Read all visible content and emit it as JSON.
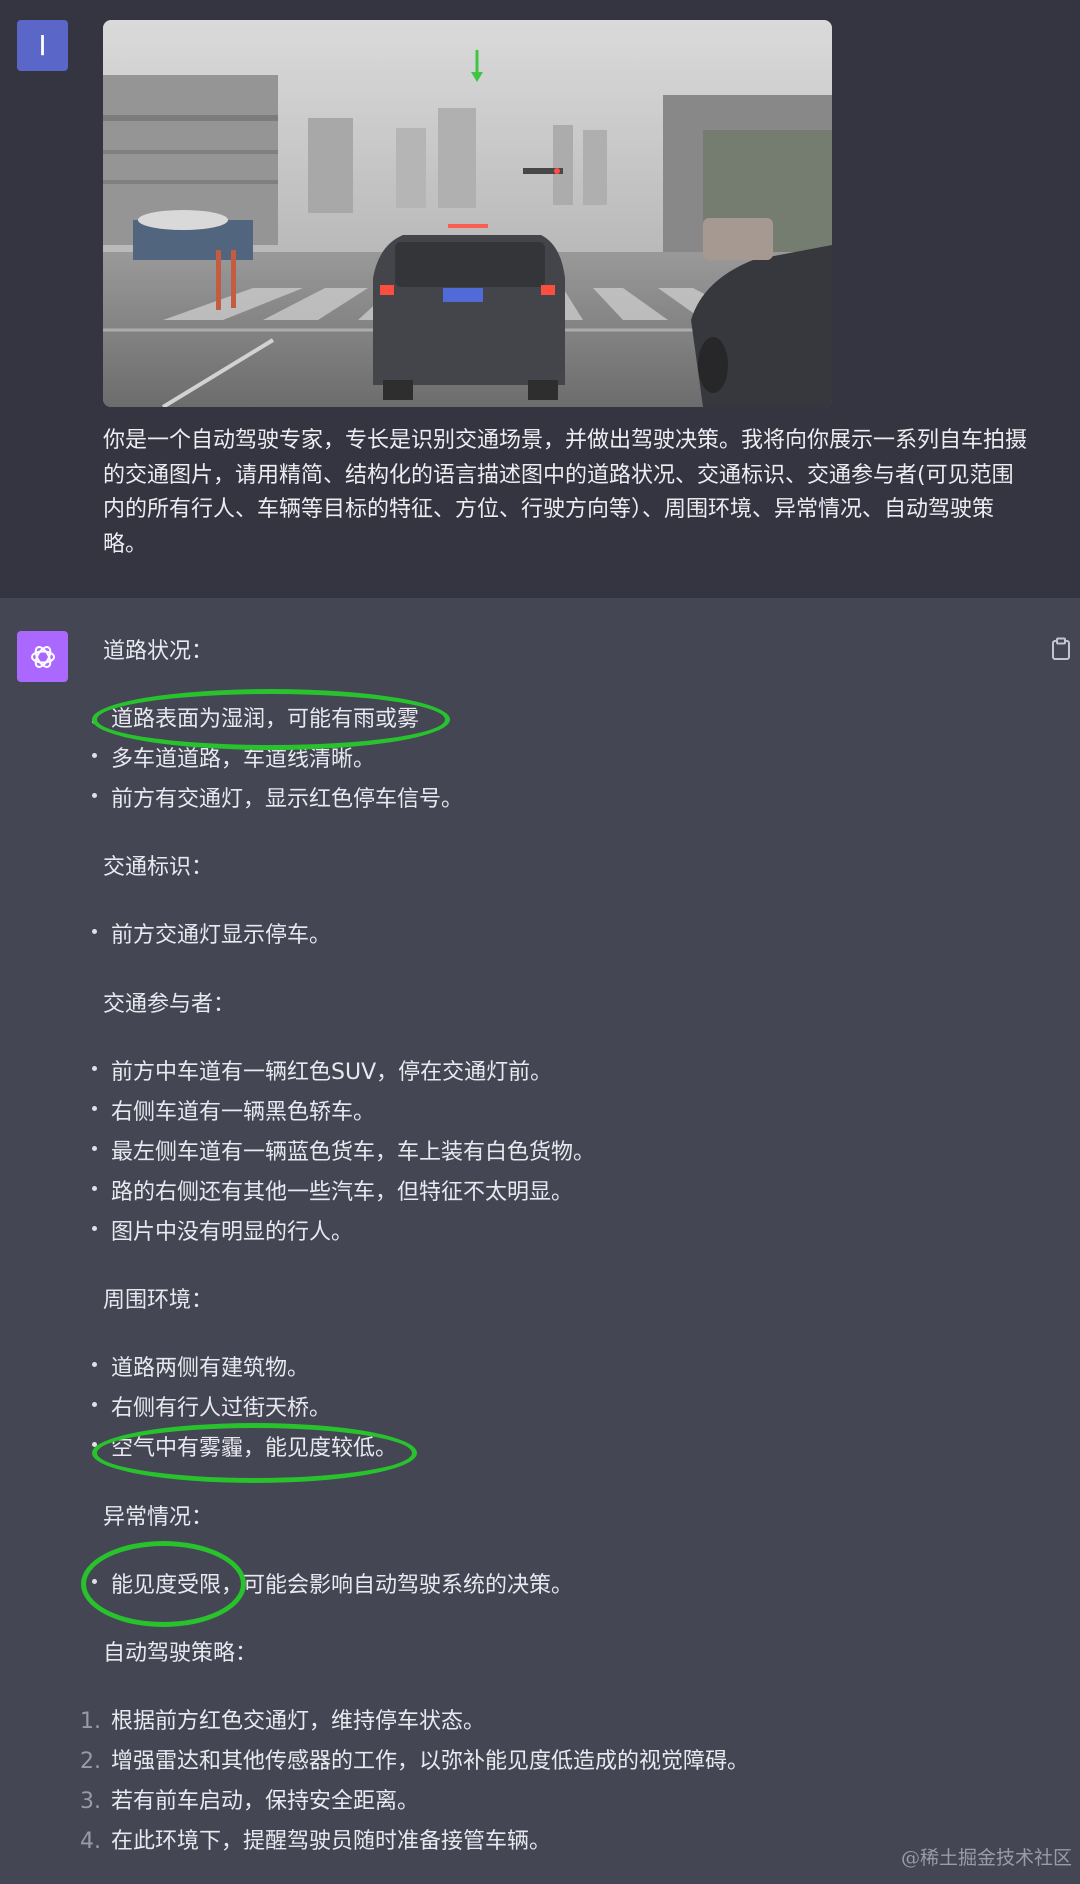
{
  "user": {
    "avatar_letter": "I",
    "prompt": "你是一个自动驾驶专家，专长是识别交通场景，并做出驾驶决策。我将向你展示一系列自车拍摄的交通图片，请用精简、结构化的语言描述图中的道路状况、交通标识、交通参与者(可见范围内的所有行人、车辆等目标的特征、方位、行驶方向等）、周围环境、异常情况、自动驾驶策略。",
    "image_label": "traffic-photo"
  },
  "assistant": {
    "sections": [
      {
        "heading": "道路状况：",
        "items": [
          "道路表面为湿润，可能有雨或雾",
          "多车道道路，车道线清晰。",
          "前方有交通灯，显示红色停车信号。"
        ]
      },
      {
        "heading": "交通标识：",
        "items": [
          "前方交通灯显示停车。"
        ]
      },
      {
        "heading": "交通参与者：",
        "items": [
          "前方中车道有一辆红色SUV，停在交通灯前。",
          "右侧车道有一辆黑色轿车。",
          "最左侧车道有一辆蓝色货车，车上装有白色货物。",
          "路的右侧还有其他一些汽车，但特征不太明显。",
          "图片中没有明显的行人。"
        ]
      },
      {
        "heading": "周围环境：",
        "items": [
          "道路两侧有建筑物。",
          "右侧有行人过街天桥。",
          "空气中有雾霾，能见度较低。"
        ]
      },
      {
        "heading": "异常情况：",
        "items": [
          "能见度受限，可能会影响自动驾驶系统的决策。"
        ]
      },
      {
        "heading": "自动驾驶策略：",
        "numbered": [
          "根据前方红色交通灯，维持停车状态。",
          "增强雷达和其他传感器的工作，以弥补能见度低造成的视觉障碍。",
          "若有前车启动，保持安全距离。",
          "在此环境下，提醒驾驶员随时准备接管车辆。"
        ]
      }
    ],
    "numbers": [
      "1.",
      "2.",
      "3.",
      "4."
    ]
  },
  "watermark": "@稀土掘金技术社区",
  "colors": {
    "user_bg": "#343541",
    "assistant_bg": "#444654",
    "highlight": "#27c22c",
    "ai_avatar": "#ab68ff",
    "user_avatar": "#5a67c9"
  }
}
